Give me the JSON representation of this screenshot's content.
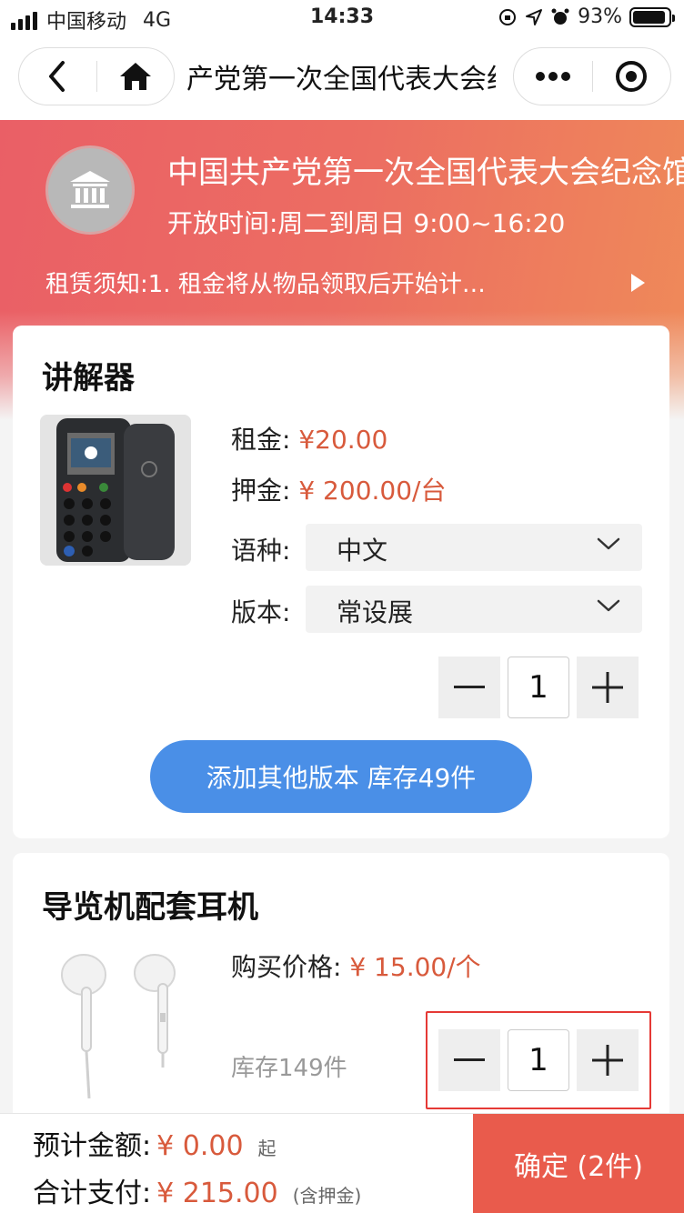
{
  "status_bar": {
    "carrier": "中国移动",
    "network": "4G",
    "time": "14:33",
    "battery": "93%",
    "battery_level": 0.93
  },
  "nav": {
    "title": "产党第一次全国代表大会纪念馆"
  },
  "hero": {
    "venue_name": "中国共产党第一次全国代表大会纪念馆",
    "hours": "开放时间:周二到周日 9:00~16:20",
    "notice": "租赁须知:1. 租金将从物品领取后开始计…"
  },
  "guide_device": {
    "title": "讲解器",
    "rent_label": "租金:",
    "rent_value": "¥20.00",
    "deposit_label": "押金:",
    "deposit_value": "¥ 200.00/台",
    "language_label": "语种:",
    "language_value": "中文",
    "version_label": "版本:",
    "version_value": "常设展",
    "quantity": "1",
    "add_version_label": "添加其他版本  库存49件"
  },
  "earphones": {
    "title": "导览机配套耳机",
    "price_label": "购买价格:",
    "price_value": "¥ 15.00/个",
    "stock": "库存149件",
    "quantity": "1"
  },
  "bottom": {
    "estimate_label": "预计金额:",
    "estimate_value": "¥ 0.00",
    "estimate_note": "起",
    "total_label": "合计支付:",
    "total_value": "¥ 215.00",
    "total_note": "(含押金)",
    "confirm_label": "确定 (2件)"
  },
  "colors": {
    "accent_red": "#e95b4c",
    "price_orange": "#d85a3c",
    "button_blue": "#4a8fe7"
  }
}
